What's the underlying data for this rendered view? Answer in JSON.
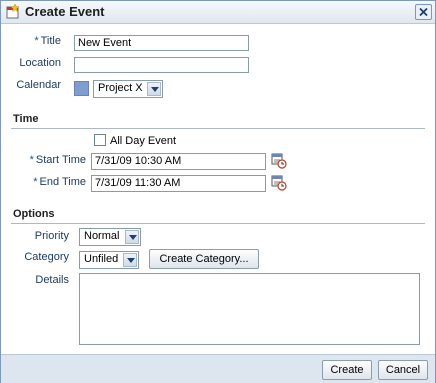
{
  "dialog": {
    "title": "Create Event",
    "icons": {
      "title": "calendar-star-icon",
      "close": "close-icon"
    }
  },
  "fields": {
    "title_label": "Title",
    "title_value": "New Event",
    "location_label": "Location",
    "location_value": "",
    "calendar_label": "Calendar",
    "calendar_value": "Project X",
    "calendar_color": "#7f9ecf"
  },
  "time": {
    "section_label": "Time",
    "all_day_label": "All Day Event",
    "all_day_checked": false,
    "start_label": "Start Time",
    "start_value": "7/31/09 10:30 AM",
    "end_label": "End Time",
    "end_value": "7/31/09 11:30 AM"
  },
  "options": {
    "section_label": "Options",
    "priority_label": "Priority",
    "priority_value": "Normal",
    "category_label": "Category",
    "category_value": "Unfiled",
    "create_category_label": "Create Category...",
    "details_label": "Details",
    "details_value": ""
  },
  "footer": {
    "create_label": "Create",
    "cancel_label": "Cancel"
  },
  "required_marker": "*"
}
